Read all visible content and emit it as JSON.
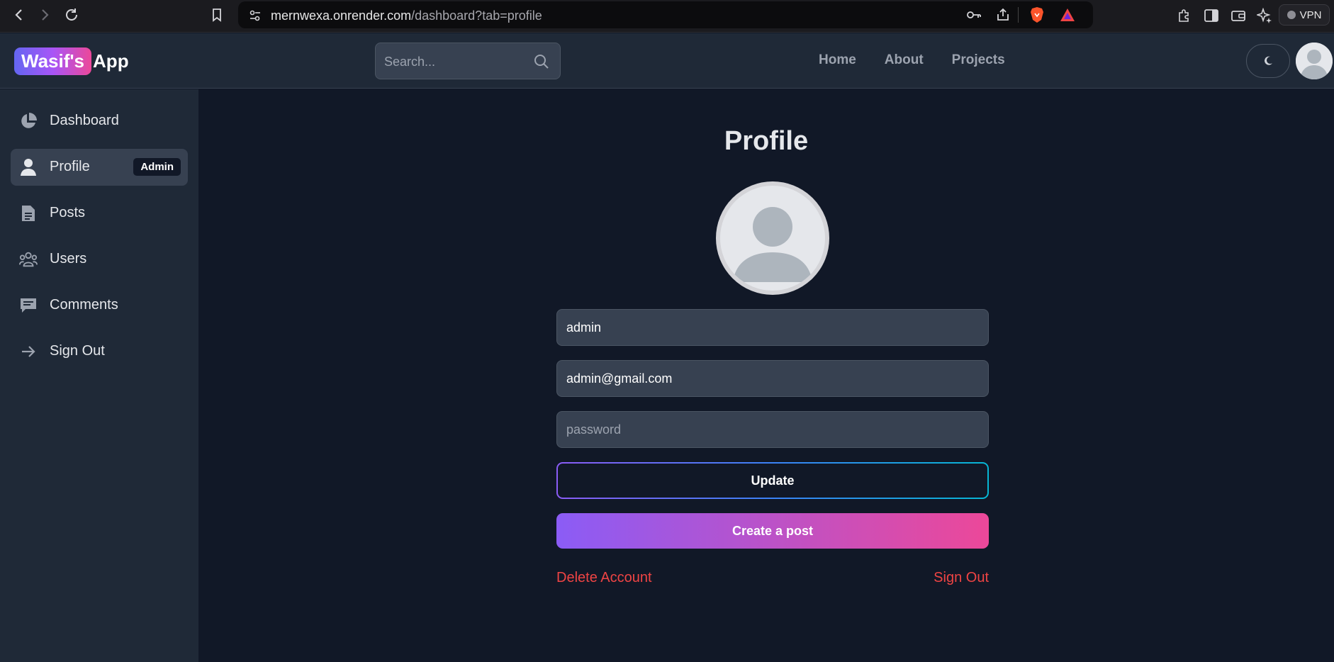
{
  "browser": {
    "url_host": "mernwexa.onrender.com",
    "url_path": "/dashboard?tab=profile",
    "vpn_label": "VPN"
  },
  "header": {
    "logo_highlight": "Wasif's",
    "logo_rest": "App",
    "search_placeholder": "Search...",
    "nav": [
      "Home",
      "About",
      "Projects"
    ]
  },
  "sidebar": {
    "items": [
      {
        "label": "Dashboard",
        "icon": "pie-chart-icon"
      },
      {
        "label": "Profile",
        "icon": "user-icon",
        "badge": "Admin",
        "active": true
      },
      {
        "label": "Posts",
        "icon": "document-icon"
      },
      {
        "label": "Users",
        "icon": "users-icon"
      },
      {
        "label": "Comments",
        "icon": "comment-icon"
      },
      {
        "label": "Sign Out",
        "icon": "arrow-right-icon"
      }
    ]
  },
  "profile": {
    "title": "Profile",
    "username_value": "admin",
    "email_value": "admin@gmail.com",
    "password_placeholder": "password",
    "update_label": "Update",
    "create_post_label": "Create a post",
    "delete_account_label": "Delete Account",
    "sign_out_label": "Sign Out"
  }
}
